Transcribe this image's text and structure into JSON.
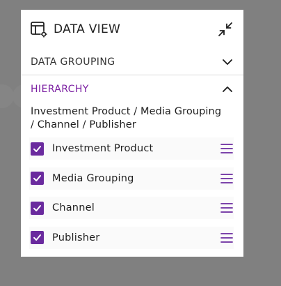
{
  "panel": {
    "title": "DATA VIEW",
    "icon": "table-settings-icon",
    "collapse_icon": "collapse-arrows-icon"
  },
  "sections": {
    "grouping": {
      "label": "DATA GROUPING",
      "state": "collapsed"
    },
    "hierarchy": {
      "label": "HIERARCHY",
      "state": "expanded"
    }
  },
  "hierarchy_path_line1": "Investment Product / Media Grouping",
  "hierarchy_path_line2": "/ Channel / Publisher",
  "items": [
    {
      "label": "Investment Product",
      "checked": true
    },
    {
      "label": "Media Grouping",
      "checked": true
    },
    {
      "label": "Channel",
      "checked": true
    },
    {
      "label": "Publisher",
      "checked": true
    }
  ],
  "colors": {
    "accent": "#6a2a9e",
    "hierarchy_label": "#7b1fa2",
    "backdrop": "#808080",
    "panel": "#ffffff"
  }
}
